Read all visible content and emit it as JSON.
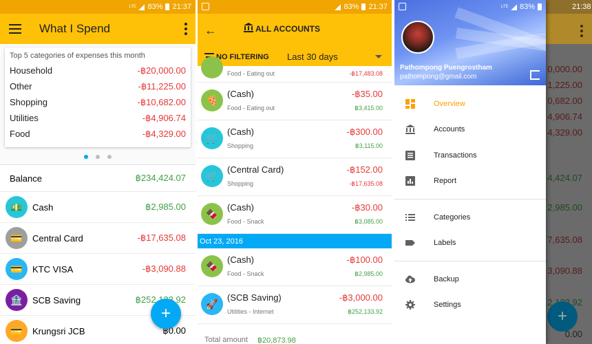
{
  "status": {
    "battery": "83%",
    "time1": "21:37",
    "time2": "21:37",
    "time3": "21:38",
    "net": "LTE"
  },
  "screen1": {
    "title": "What I Spend",
    "card_title": "Top 5 categories of expenses this month",
    "categories": [
      {
        "name": "Household",
        "amount": "-฿20,000.00"
      },
      {
        "name": "Other",
        "amount": "-฿11,225.00"
      },
      {
        "name": "Shopping",
        "amount": "-฿10,682.00"
      },
      {
        "name": "Utilities",
        "amount": "-฿4,906.74"
      },
      {
        "name": "Food",
        "amount": "-฿4,329.00"
      }
    ],
    "balance_label": "Balance",
    "balance_value": "฿234,424.07",
    "accounts": [
      {
        "name": "Cash",
        "amount": "฿2,985.00",
        "color": "#26c6da",
        "sign": "pos"
      },
      {
        "name": "Central Card",
        "amount": "-฿17,635.08",
        "color": "#9e9e9e",
        "sign": "neg"
      },
      {
        "name": "KTC VISA",
        "amount": "-฿3,090.88",
        "color": "#29b6f6",
        "sign": "neg"
      },
      {
        "name": "SCB Saving",
        "amount": "฿252,133.92",
        "color": "#7b1fa2",
        "sign": "pos"
      },
      {
        "name": "Krungsri JCB",
        "amount": "฿0.00",
        "color": "#ffa726",
        "sign": "zero"
      }
    ],
    "fab": "+"
  },
  "screen2": {
    "title": "ALL ACCOUNTS",
    "filter": "NO FILTERING",
    "period": "Last 30 days",
    "partial": {
      "category": "Food - Eating out",
      "balance": "-฿17,483.08"
    },
    "transactions": [
      {
        "name": "(Cash)",
        "category": "Food - Eating out",
        "amount": "-฿35.00",
        "balance": "฿3,415.00",
        "bal_sign": "pos",
        "color": "#8bc34a",
        "icon": "🍕"
      },
      {
        "name": "(Cash)",
        "category": "Shopping",
        "amount": "-฿300.00",
        "balance": "฿3,115.00",
        "bal_sign": "pos",
        "color": "#26c6da",
        "icon": "🛒"
      },
      {
        "name": "(Central Card)",
        "category": "Shopping",
        "amount": "-฿152.00",
        "balance": "-฿17,635.08",
        "bal_sign": "neg",
        "color": "#26c6da",
        "icon": "🛒"
      },
      {
        "name": "(Cash)",
        "category": "Food - Snack",
        "amount": "-฿30.00",
        "balance": "฿3,085.00",
        "bal_sign": "pos",
        "color": "#8bc34a",
        "icon": "🍫"
      }
    ],
    "date_header": "Oct 23, 2016",
    "transactions2": [
      {
        "name": "(Cash)",
        "category": "Food - Snack",
        "amount": "-฿100.00",
        "balance": "฿2,985.00",
        "bal_sign": "pos",
        "color": "#8bc34a",
        "icon": "🍫"
      },
      {
        "name": "(SCB Saving)",
        "category": "Utilities - Internet",
        "amount": "-฿3,000.00",
        "balance": "฿252,133.92",
        "bal_sign": "pos",
        "color": "#29b6f6",
        "icon": "🚀"
      }
    ],
    "total_label": "Total amount",
    "total_value": "฿20,873.98"
  },
  "screen3": {
    "user_name": "Pathompong Puengrostham",
    "user_email": "pathompong@gmail.com",
    "menu1": [
      {
        "label": "Overview",
        "icon": "dashboard-icon",
        "active": true
      },
      {
        "label": "Accounts",
        "icon": "bank-icon"
      },
      {
        "label": "Transactions",
        "icon": "list-box-icon"
      },
      {
        "label": "Report",
        "icon": "chart-icon"
      }
    ],
    "menu2": [
      {
        "label": "Categories",
        "icon": "list-icon"
      },
      {
        "label": "Labels",
        "icon": "label-icon"
      }
    ],
    "menu3": [
      {
        "label": "Backup",
        "icon": "cloud-upload-icon"
      },
      {
        "label": "Settings",
        "icon": "gear-icon"
      }
    ],
    "bg_values": [
      "0,000.00",
      "1,225.00",
      "0,682.00",
      "4,906.74",
      "4,329.00",
      "4,424.07",
      "2,985.00",
      "7,635.08",
      "3,090.88",
      "2,133.92",
      "0.00"
    ]
  }
}
